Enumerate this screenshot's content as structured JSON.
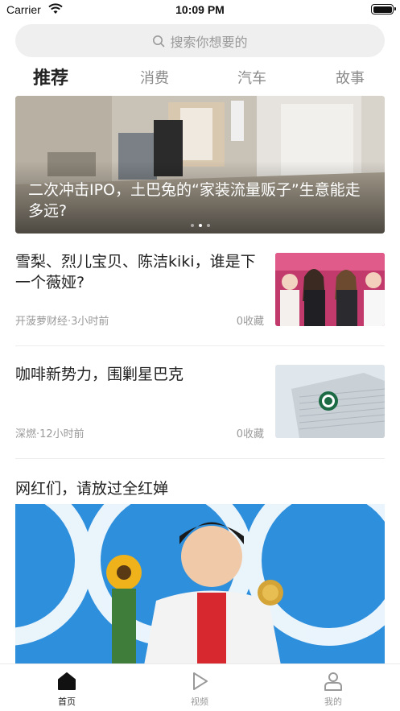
{
  "status_bar": {
    "carrier": "Carrier",
    "time": "10:09 PM"
  },
  "search": {
    "placeholder": "搜索你想要的"
  },
  "tabs": [
    {
      "label": "推荐",
      "active": true
    },
    {
      "label": "消费",
      "active": false
    },
    {
      "label": "汽车",
      "active": false
    },
    {
      "label": "故事",
      "active": false
    }
  ],
  "banner": {
    "title": "二次冲击IPO，土巴兔的“家装流量贩子”生意能走多远?",
    "dots": 3,
    "active_dot": 1
  },
  "articles": [
    {
      "title": "雪梨、烈儿宝贝、陈洁kiki，谁是下一个薇娅?",
      "meta": "开菠萝财经·3小时前",
      "favorites": "0收藏"
    },
    {
      "title": "咖啡新势力，围剿星巴克",
      "meta": "深燃·12小时前",
      "favorites": "0收藏"
    }
  ],
  "feature": {
    "title": "网红们，请放过全红婵"
  },
  "bottom_nav": [
    {
      "label": "首页",
      "icon": "home-icon",
      "active": true
    },
    {
      "label": "视频",
      "icon": "play-icon",
      "active": false
    },
    {
      "label": "我的",
      "icon": "user-icon",
      "active": false
    }
  ],
  "colors": {
    "accent": "#222222",
    "muted": "#9a9a9a",
    "search_bg": "#efefef"
  }
}
